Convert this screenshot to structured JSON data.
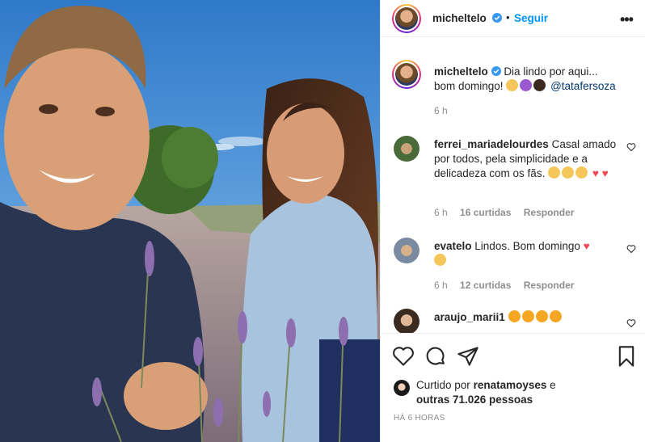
{
  "post": {
    "author": "micheltelo",
    "follow_label": "Seguir",
    "more_label": "•••",
    "caption_text": "Dia lindo por aqui... bom domingo!",
    "caption_mention": "@tatafersoza",
    "caption_time": "6 h"
  },
  "comments": [
    {
      "user": "ferrei_mariadelourdes",
      "text": "Casal amado por todos, pela simplicidade e a delicadeza com os fãs.",
      "time": "6 h",
      "likes": "16 curtidas",
      "reply": "Responder"
    },
    {
      "user": "evatelo",
      "text": "Lindos. Bom domingo",
      "time": "6 h",
      "likes": "12 curtidas",
      "reply": "Responder"
    },
    {
      "user": "araujo_marii1",
      "text": ""
    }
  ],
  "likes": {
    "prefix": "Curtido por",
    "user": "renatamoyses",
    "conj": "e",
    "others": "outras 71.026 pessoas"
  },
  "timestamp": "HÁ 6 HORAS",
  "icons": [
    "verified-badge-icon",
    "heart-icon",
    "comment-icon",
    "share-icon",
    "bookmark-icon",
    "more-options-icon"
  ],
  "colors": {
    "accent": "#0095f6",
    "heart": "#ed4956",
    "muted": "#8e8e8e"
  }
}
